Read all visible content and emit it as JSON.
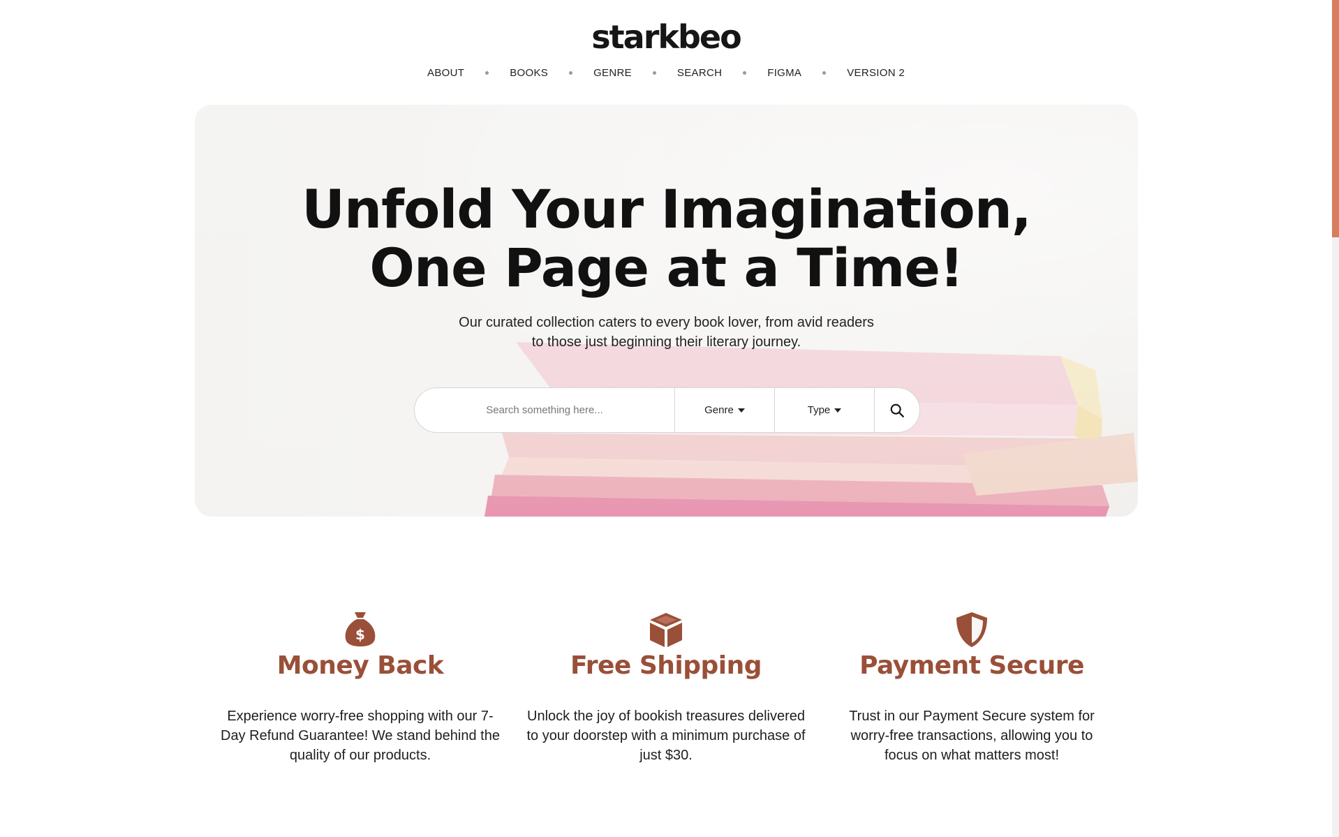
{
  "brand": {
    "logo_text": "starkbeo",
    "accent": "#9a4f38"
  },
  "nav": {
    "items": [
      {
        "label": "ABOUT"
      },
      {
        "label": "BOOKS"
      },
      {
        "label": "GENRE"
      },
      {
        "label": "SEARCH"
      },
      {
        "label": "FIGMA"
      },
      {
        "label": "VERSION 2"
      }
    ]
  },
  "hero": {
    "title_line1": "Unfold Your Imagination,",
    "title_line2": "One Page at a Time!",
    "subtitle": "Our curated collection caters to every book lover, from avid readers to those just beginning their literary journey."
  },
  "search": {
    "placeholder": "Search something here...",
    "genre_label": "Genre",
    "type_label": "Type",
    "button_icon": "search-icon"
  },
  "features": [
    {
      "icon": "money-bag-icon",
      "title": "Money Back",
      "description": "Experience worry-free shopping with our 7-Day Refund Guarantee! We stand behind the quality of our products."
    },
    {
      "icon": "box-icon",
      "title": "Free Shipping",
      "description": "Unlock the joy of bookish treasures delivered to your doorstep with a minimum purchase of just $30."
    },
    {
      "icon": "shield-icon",
      "title": "Payment Secure",
      "description": "Trust in our Payment Secure system for worry-free transactions, allowing you to focus on what matters most!"
    }
  ]
}
